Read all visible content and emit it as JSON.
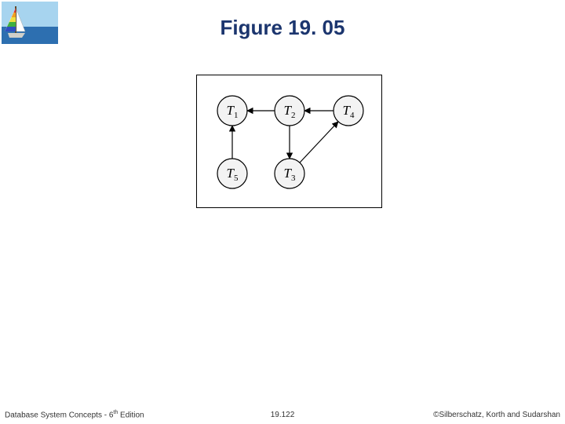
{
  "title": "Figure 19. 05",
  "footer": {
    "left_book": "Database System Concepts - ",
    "left_edition_num": "6",
    "left_edition_suffix": "th",
    "left_tail": " Edition",
    "center": "19.122",
    "right": "©Silberschatz, Korth and Sudarshan"
  },
  "nodes": {
    "t1": {
      "label_main": "T",
      "label_sub": "1"
    },
    "t2": {
      "label_main": "T",
      "label_sub": "2"
    },
    "t3": {
      "label_main": "T",
      "label_sub": "3"
    },
    "t4": {
      "label_main": "T",
      "label_sub": "4"
    },
    "t5": {
      "label_main": "T",
      "label_sub": "5"
    }
  },
  "chart_data": {
    "type": "diagram",
    "title": "Figure 19.05",
    "nodes": [
      "T1",
      "T2",
      "T3",
      "T4",
      "T5"
    ],
    "edges": [
      {
        "from": "T2",
        "to": "T1"
      },
      {
        "from": "T4",
        "to": "T2"
      },
      {
        "from": "T5",
        "to": "T1"
      },
      {
        "from": "T2",
        "to": "T3"
      },
      {
        "from": "T3",
        "to": "T4"
      }
    ],
    "layout_hint": {
      "T1": {
        "row": 0,
        "col": 0
      },
      "T2": {
        "row": 0,
        "col": 1
      },
      "T4": {
        "row": 0,
        "col": 2
      },
      "T5": {
        "row": 1,
        "col": 0
      },
      "T3": {
        "row": 1,
        "col": 1
      }
    }
  }
}
